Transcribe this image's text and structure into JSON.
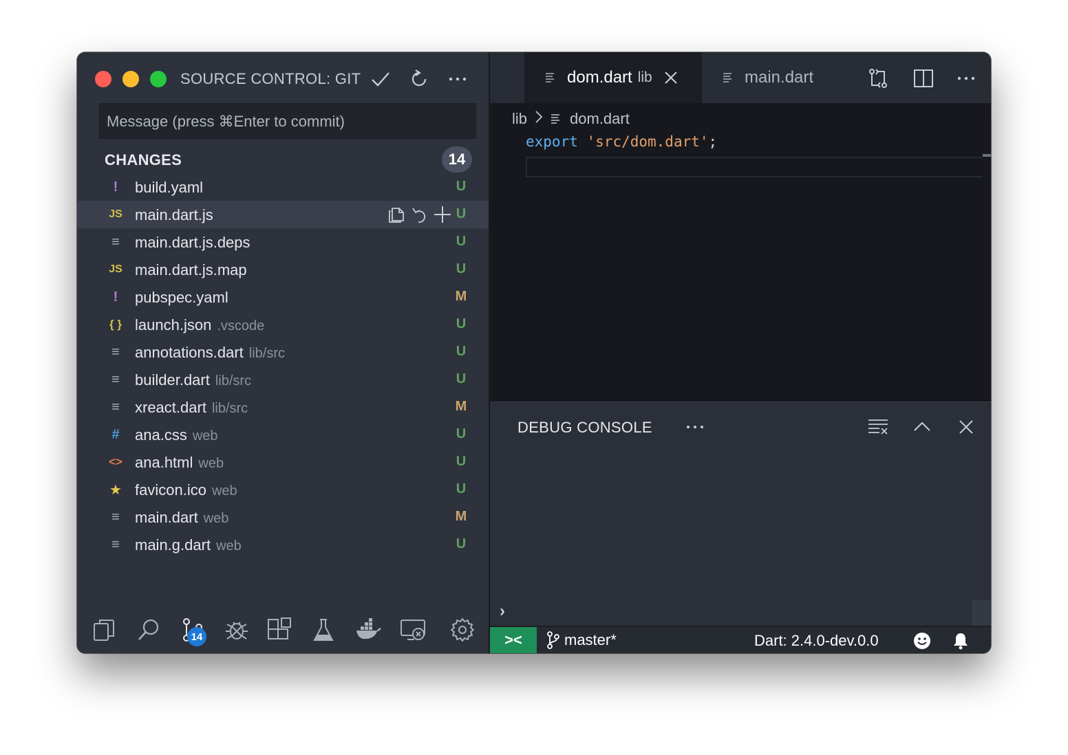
{
  "sidebar": {
    "title": "SOURCE CONTROL: GIT",
    "commit_placeholder": "Message (press ⌘Enter to commit)",
    "changes_label": "CHANGES",
    "changes_count": "14",
    "files": [
      {
        "icon": "!",
        "icon_color": "#b47fd6",
        "name": "build.yaml",
        "dir": "",
        "status": "U"
      },
      {
        "icon": "JS",
        "icon_color": "#d4c04a",
        "name": "main.dart.js",
        "dir": "",
        "status": "U"
      },
      {
        "icon": "≡",
        "icon_color": "#aab0ba",
        "name": "main.dart.js.deps",
        "dir": "",
        "status": "U"
      },
      {
        "icon": "JS",
        "icon_color": "#d4c04a",
        "name": "main.dart.js.map",
        "dir": "",
        "status": "U"
      },
      {
        "icon": "!",
        "icon_color": "#b47fd6",
        "name": "pubspec.yaml",
        "dir": "",
        "status": "M"
      },
      {
        "icon": "{ }",
        "icon_color": "#d4c04a",
        "name": "launch.json",
        "dir": ".vscode",
        "status": "U"
      },
      {
        "icon": "≡",
        "icon_color": "#aab0ba",
        "name": "annotations.dart",
        "dir": "lib/src",
        "status": "U"
      },
      {
        "icon": "≡",
        "icon_color": "#aab0ba",
        "name": "builder.dart",
        "dir": "lib/src",
        "status": "U"
      },
      {
        "icon": "≡",
        "icon_color": "#aab0ba",
        "name": "xreact.dart",
        "dir": "lib/src",
        "status": "M"
      },
      {
        "icon": "#",
        "icon_color": "#4a9ad8",
        "name": "ana.css",
        "dir": "web",
        "status": "U"
      },
      {
        "icon": "<>",
        "icon_color": "#e07a4a",
        "name": "ana.html",
        "dir": "web",
        "status": "U"
      },
      {
        "icon": "★",
        "icon_color": "#e8c84a",
        "name": "favicon.ico",
        "dir": "web",
        "status": "U"
      },
      {
        "icon": "≡",
        "icon_color": "#aab0ba",
        "name": "main.dart",
        "dir": "web",
        "status": "M"
      },
      {
        "icon": "≡",
        "icon_color": "#aab0ba",
        "name": "main.g.dart",
        "dir": "web",
        "status": "U"
      }
    ],
    "scm_badge": "14"
  },
  "editor": {
    "tabs": [
      {
        "label": "dom.dart",
        "desc": "lib",
        "active": true
      },
      {
        "label": "main.dart",
        "desc": "",
        "active": false
      }
    ],
    "breadcrumb": {
      "folder": "lib",
      "file": "dom.dart"
    },
    "code": {
      "keyword": "export",
      "string": "'src/dom.dart'",
      "punct": ";"
    }
  },
  "panel": {
    "title": "DEBUG CONSOLE",
    "more": "···",
    "prompt": "›"
  },
  "statusbar": {
    "remote": "><",
    "branch": "master*",
    "dart_version": "Dart: 2.4.0-dev.0.0"
  },
  "colors": {
    "accent_remote": "#1f8f5a",
    "badge": "#1f7ad6",
    "status_untracked": "#5fa05f",
    "status_modified": "#c9a46a"
  }
}
